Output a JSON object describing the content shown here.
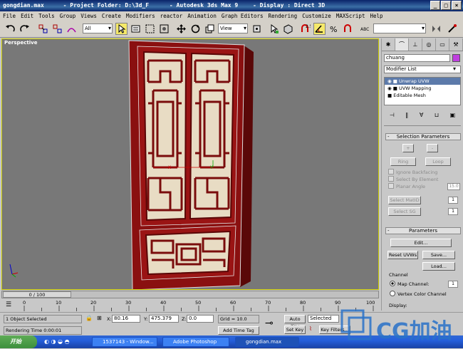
{
  "titlebar": {
    "file": "gongdian.max",
    "project_folder": "- Project Folder: D:\\3d_F",
    "app": "- Autodesk 3ds Max 9",
    "display": "- Display : Direct 3D"
  },
  "menu": [
    "File",
    "Edit",
    "Tools",
    "Group",
    "Views",
    "Create",
    "Modifiers",
    "reactor",
    "Animation",
    "Graph Editors",
    "Rendering",
    "Customize",
    "MAXScript",
    "Help"
  ],
  "toolbar": {
    "selection_filter": "All",
    "reference_coord": "View",
    "named_selection": ""
  },
  "viewport": {
    "label": "Perspective"
  },
  "command_panel": {
    "object_name": "chuang",
    "object_color": "#c040e0",
    "modifier_list_label": "Modifier List",
    "stack": [
      "Unwrap UVW",
      "UVW Mapping",
      "Editable Mesh"
    ],
    "selection_params": {
      "title": "Selection Parameters",
      "plus": "+",
      "minus": "-",
      "ring": "Ring",
      "loop": "Loop",
      "ignore_backfacing": "Ignore Backfacing",
      "select_by_element": "Select By Element",
      "planar_angle": "Planar Angle",
      "planar_angle_value": "15.0",
      "select_matid": "Select MatID",
      "matid_value": "1",
      "select_sg": "Select SG",
      "sg_value": "1"
    },
    "parameters": {
      "title": "Parameters",
      "edit": "Edit...",
      "reset_uvws": "Reset UVWs",
      "save": "Save...",
      "load": "Load...",
      "channel_label": "Channel",
      "map_channel": "Map Channel:",
      "map_channel_value": "1",
      "vertex_color_channel": "Vertex Color Channel",
      "display_label": "Display:"
    }
  },
  "timeslider": {
    "position": "0 / 100",
    "ticks": [
      "0",
      "10",
      "20",
      "30",
      "40",
      "50",
      "60",
      "70",
      "80",
      "90",
      "100"
    ]
  },
  "status": {
    "selection": "1 Object Selected",
    "prompt": "Rendering Time  0:00:01",
    "x_label": "X:",
    "x_value": "80.16",
    "y_label": "Y:",
    "y_value": "475.379",
    "z_label": "Z:",
    "z_value": "0.0",
    "grid": "Grid = 10.0",
    "add_time_tag": "Add Time Tag",
    "auto_key": "Auto Key",
    "set_key": "Set Key",
    "key_mode": "Selected",
    "key_filters": "Key Filters..."
  },
  "taskbar": {
    "start": "开始",
    "tasks": [
      "1537143 - Window...",
      "Adobe Photoshop",
      "gongdian.max"
    ]
  },
  "watermark": {
    "text": "CG加油"
  },
  "colors": {
    "viewport_bg": "#787878",
    "door_frame": "#8a1010",
    "panel_cream": "#e8dcc4",
    "active_border": "#c8c800"
  }
}
